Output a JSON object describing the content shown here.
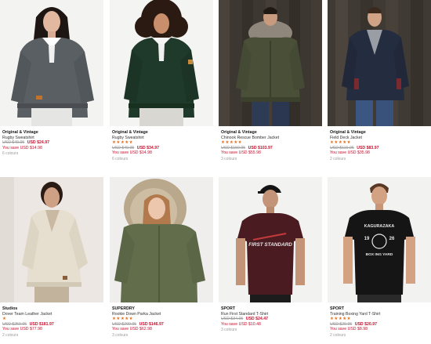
{
  "products": [
    {
      "brand": "Original & Vintage",
      "title": "Rugby Sweatshirt",
      "stars": "",
      "was_price": "USD $49.95",
      "now_price": "USD $24.97",
      "save": "You save USD $14.98",
      "colours": "6 colours"
    },
    {
      "brand": "Original & Vintage",
      "title": "Rugby Sweatshirt",
      "stars": "★★★★★",
      "was_price": "USD $49.95",
      "now_price": "USD $34.97",
      "save": "You save USD $14.98",
      "colours": "6 colours"
    },
    {
      "brand": "Original & Vintage",
      "title": "Chinook Rescue Bomber Jacket",
      "stars": "★★★★★",
      "was_price": "USD $159.95",
      "now_price": "USD $103.97",
      "save": "You save USD $55.98",
      "colours": "3 colours"
    },
    {
      "brand": "Original & Vintage",
      "title": "Field Deck Jacket",
      "stars": "★★★★★",
      "was_price": "USD $119.95",
      "now_price": "USD $83.97",
      "save": "You save USD $35.98",
      "colours": "2 colours"
    },
    {
      "brand": "Studios",
      "title": "Dover Team Leather Jacket",
      "stars": "★",
      "was_price": "USD $259.95",
      "now_price": "USD $181.97",
      "save": "You save USD $77.98",
      "colours": "2 colours"
    },
    {
      "brand": "SUPERDRY",
      "title": "Rookie Down Parka Jacket",
      "stars": "★★★★★",
      "was_price": "USD $209.95",
      "now_price": "USD $146.97",
      "save": "You save USD $62.98",
      "colours": "3 colours"
    },
    {
      "brand": "SPORT",
      "title": "Run First Standard T-Shirt",
      "stars": "",
      "was_price": "USD $34.95",
      "now_price": "USD $24.47",
      "save": "You save USD $10.48",
      "colours": "3 colours"
    },
    {
      "brand": "SPORT",
      "title": "Training Boxing Yard T-Shirt",
      "stars": "★★★★★",
      "was_price": "USD $29.95",
      "now_price": "USD $20.97",
      "save": "You save USD $8.98",
      "colours": "2 colours"
    }
  ],
  "graphics": {
    "run_first_print": "FIRST STANDARD",
    "boxing_print_top": "KAGURAZAKA",
    "boxing_print_year_left": "19",
    "boxing_print_year_right": "26",
    "boxing_print_bottom": "BOX ING YARD"
  },
  "colors": {
    "sale_red": "#c8102e",
    "star_orange": "#e6701a",
    "muted_grey": "#9a9a9a"
  }
}
